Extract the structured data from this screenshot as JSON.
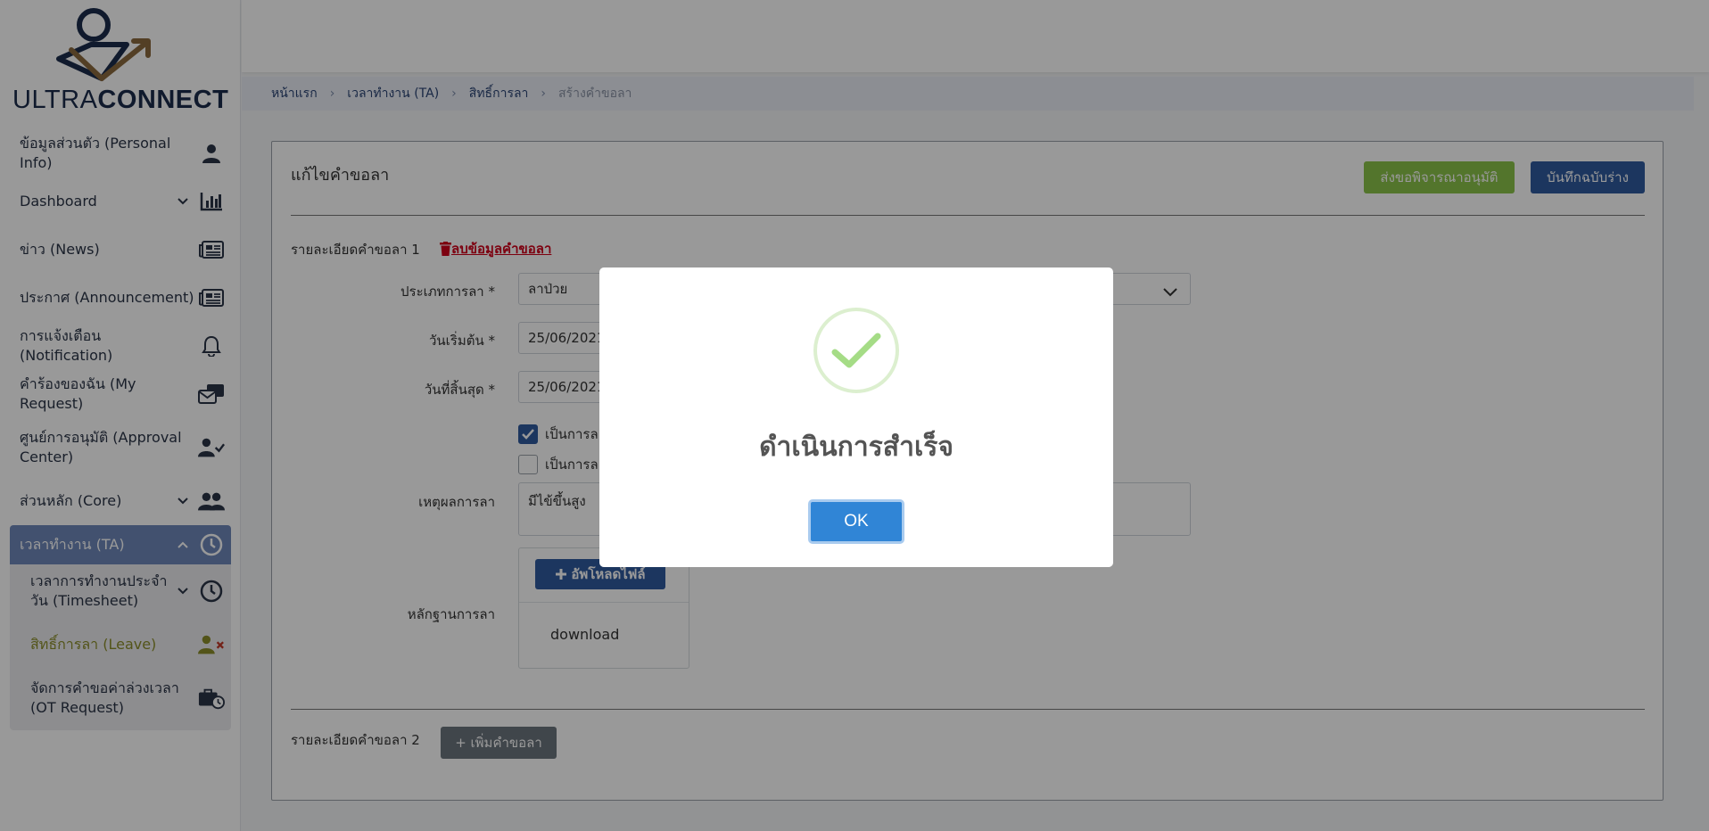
{
  "logo": {
    "part1": "ULTRA",
    "part2": "CONNECT"
  },
  "sidebar": {
    "items": [
      {
        "label": "ข้อมูลส่วนตัว (Personal Info)",
        "icon": "user-icon"
      },
      {
        "label": "Dashboard",
        "icon": "bar-chart-icon",
        "has_chevron": true
      },
      {
        "label": "ข่าว (News)",
        "icon": "newspaper-icon"
      },
      {
        "label": "ประกาศ (Announcement)",
        "icon": "newspaper-icon"
      },
      {
        "label": "การแจ้งเตือน (Notification)",
        "icon": "bell-icon"
      },
      {
        "label": "คำร้องของฉัน (My Request)",
        "icon": "mail-stack-icon"
      },
      {
        "label": "ศูนย์การอนุมัติ (Approval Center)",
        "icon": "user-check-icon"
      },
      {
        "label": "ส่วนหลัก (Core)",
        "icon": "users-icon",
        "has_chevron": true
      },
      {
        "label": "เวลาทำงาน (TA)",
        "icon": "clock-icon",
        "active": true
      }
    ],
    "sub_items": [
      {
        "label": "เวลาการทำงานประจำวัน (Timesheet)",
        "icon": "clock-icon"
      },
      {
        "label": "สิทธิ์การลา (Leave)",
        "icon": "user-times-icon",
        "selected": true
      },
      {
        "label": "จัดการคำขอค่าล่วงเวลา (OT Request)",
        "icon": "briefcase-clock-icon"
      }
    ]
  },
  "breadcrumb": {
    "items": [
      "หน้าแรก",
      "เวลาทำงาน (TA)",
      "สิทธิ์การลา"
    ],
    "current": "สร้างคำขอลา",
    "separator": "›"
  },
  "card": {
    "title": "แก้ไขคำขอลา",
    "submit_label": "ส่งขอพิจารณาอนุมัติ",
    "draft_label": "บันทึกฉบับร่าง"
  },
  "form": {
    "detail1_label": "รายละเอียดคำขอลา 1",
    "delete_label": "ลบข้อมูลคำขอลา",
    "leave_type_label": "ประเภทการลา *",
    "leave_type_value": "ลาป่วย",
    "start_date_label": "วันเริ่มต้น *",
    "start_date_value": "25/06/2021",
    "end_date_label": "วันที่สิ้นสุด *",
    "end_date_value": "25/06/2021",
    "check1_label": "เป็นการล",
    "check1_checked": true,
    "check2_label": "เป็นการล",
    "check2_checked": false,
    "reason_label": "เหตุผลการลา",
    "reason_value": "มีไข้ขึ้นสูง",
    "evidence_label": "หลักฐานการลา",
    "upload_label": "อัพโหลดไฟล์",
    "download_label": "download",
    "detail2_label": "รายละเอียดคำขอลา 2",
    "add_label": "+ เพิ่มคำขอลา"
  },
  "modal": {
    "title": "ดำเนินการสำเร็จ",
    "ok_label": "OK",
    "icon": "success-check-icon"
  },
  "colors": {
    "primary": "#2f5b9e",
    "success": "#8bc34a",
    "danger": "#d0021b",
    "ok_button": "#3085d6",
    "active_nav": "#6e88b9"
  }
}
